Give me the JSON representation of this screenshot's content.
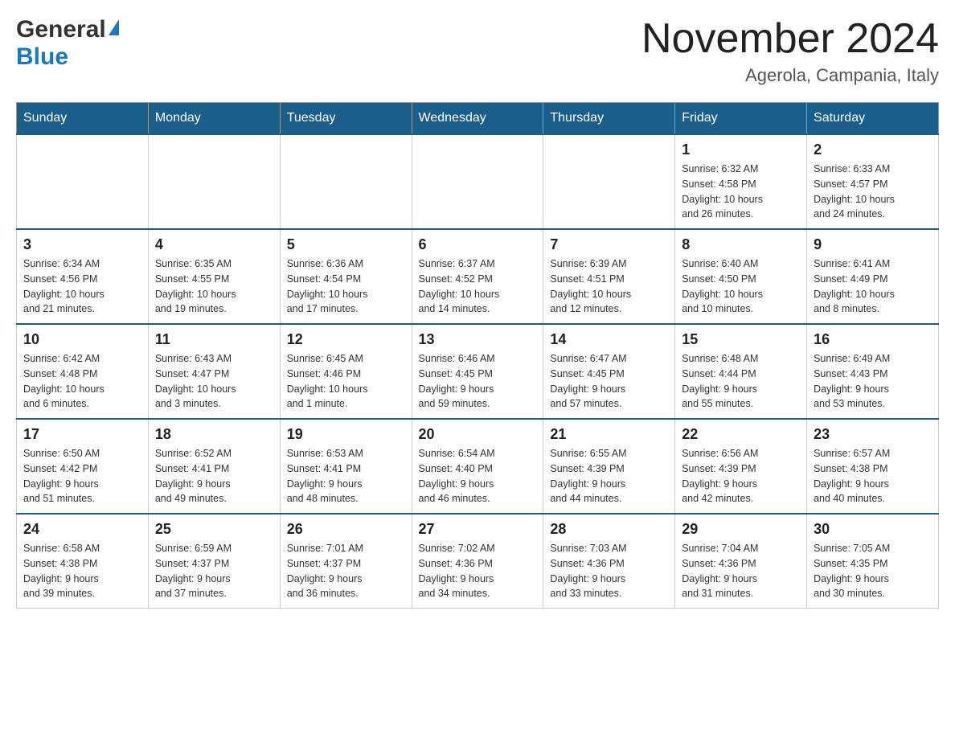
{
  "header": {
    "logo_general": "General",
    "logo_blue": "Blue",
    "title": "November 2024",
    "location": "Agerola, Campania, Italy"
  },
  "days_of_week": [
    "Sunday",
    "Monday",
    "Tuesday",
    "Wednesday",
    "Thursday",
    "Friday",
    "Saturday"
  ],
  "weeks": [
    [
      {
        "day": "",
        "info": ""
      },
      {
        "day": "",
        "info": ""
      },
      {
        "day": "",
        "info": ""
      },
      {
        "day": "",
        "info": ""
      },
      {
        "day": "",
        "info": ""
      },
      {
        "day": "1",
        "info": "Sunrise: 6:32 AM\nSunset: 4:58 PM\nDaylight: 10 hours\nand 26 minutes."
      },
      {
        "day": "2",
        "info": "Sunrise: 6:33 AM\nSunset: 4:57 PM\nDaylight: 10 hours\nand 24 minutes."
      }
    ],
    [
      {
        "day": "3",
        "info": "Sunrise: 6:34 AM\nSunset: 4:56 PM\nDaylight: 10 hours\nand 21 minutes."
      },
      {
        "day": "4",
        "info": "Sunrise: 6:35 AM\nSunset: 4:55 PM\nDaylight: 10 hours\nand 19 minutes."
      },
      {
        "day": "5",
        "info": "Sunrise: 6:36 AM\nSunset: 4:54 PM\nDaylight: 10 hours\nand 17 minutes."
      },
      {
        "day": "6",
        "info": "Sunrise: 6:37 AM\nSunset: 4:52 PM\nDaylight: 10 hours\nand 14 minutes."
      },
      {
        "day": "7",
        "info": "Sunrise: 6:39 AM\nSunset: 4:51 PM\nDaylight: 10 hours\nand 12 minutes."
      },
      {
        "day": "8",
        "info": "Sunrise: 6:40 AM\nSunset: 4:50 PM\nDaylight: 10 hours\nand 10 minutes."
      },
      {
        "day": "9",
        "info": "Sunrise: 6:41 AM\nSunset: 4:49 PM\nDaylight: 10 hours\nand 8 minutes."
      }
    ],
    [
      {
        "day": "10",
        "info": "Sunrise: 6:42 AM\nSunset: 4:48 PM\nDaylight: 10 hours\nand 6 minutes."
      },
      {
        "day": "11",
        "info": "Sunrise: 6:43 AM\nSunset: 4:47 PM\nDaylight: 10 hours\nand 3 minutes."
      },
      {
        "day": "12",
        "info": "Sunrise: 6:45 AM\nSunset: 4:46 PM\nDaylight: 10 hours\nand 1 minute."
      },
      {
        "day": "13",
        "info": "Sunrise: 6:46 AM\nSunset: 4:45 PM\nDaylight: 9 hours\nand 59 minutes."
      },
      {
        "day": "14",
        "info": "Sunrise: 6:47 AM\nSunset: 4:45 PM\nDaylight: 9 hours\nand 57 minutes."
      },
      {
        "day": "15",
        "info": "Sunrise: 6:48 AM\nSunset: 4:44 PM\nDaylight: 9 hours\nand 55 minutes."
      },
      {
        "day": "16",
        "info": "Sunrise: 6:49 AM\nSunset: 4:43 PM\nDaylight: 9 hours\nand 53 minutes."
      }
    ],
    [
      {
        "day": "17",
        "info": "Sunrise: 6:50 AM\nSunset: 4:42 PM\nDaylight: 9 hours\nand 51 minutes."
      },
      {
        "day": "18",
        "info": "Sunrise: 6:52 AM\nSunset: 4:41 PM\nDaylight: 9 hours\nand 49 minutes."
      },
      {
        "day": "19",
        "info": "Sunrise: 6:53 AM\nSunset: 4:41 PM\nDaylight: 9 hours\nand 48 minutes."
      },
      {
        "day": "20",
        "info": "Sunrise: 6:54 AM\nSunset: 4:40 PM\nDaylight: 9 hours\nand 46 minutes."
      },
      {
        "day": "21",
        "info": "Sunrise: 6:55 AM\nSunset: 4:39 PM\nDaylight: 9 hours\nand 44 minutes."
      },
      {
        "day": "22",
        "info": "Sunrise: 6:56 AM\nSunset: 4:39 PM\nDaylight: 9 hours\nand 42 minutes."
      },
      {
        "day": "23",
        "info": "Sunrise: 6:57 AM\nSunset: 4:38 PM\nDaylight: 9 hours\nand 40 minutes."
      }
    ],
    [
      {
        "day": "24",
        "info": "Sunrise: 6:58 AM\nSunset: 4:38 PM\nDaylight: 9 hours\nand 39 minutes."
      },
      {
        "day": "25",
        "info": "Sunrise: 6:59 AM\nSunset: 4:37 PM\nDaylight: 9 hours\nand 37 minutes."
      },
      {
        "day": "26",
        "info": "Sunrise: 7:01 AM\nSunset: 4:37 PM\nDaylight: 9 hours\nand 36 minutes."
      },
      {
        "day": "27",
        "info": "Sunrise: 7:02 AM\nSunset: 4:36 PM\nDaylight: 9 hours\nand 34 minutes."
      },
      {
        "day": "28",
        "info": "Sunrise: 7:03 AM\nSunset: 4:36 PM\nDaylight: 9 hours\nand 33 minutes."
      },
      {
        "day": "29",
        "info": "Sunrise: 7:04 AM\nSunset: 4:36 PM\nDaylight: 9 hours\nand 31 minutes."
      },
      {
        "day": "30",
        "info": "Sunrise: 7:05 AM\nSunset: 4:35 PM\nDaylight: 9 hours\nand 30 minutes."
      }
    ]
  ]
}
